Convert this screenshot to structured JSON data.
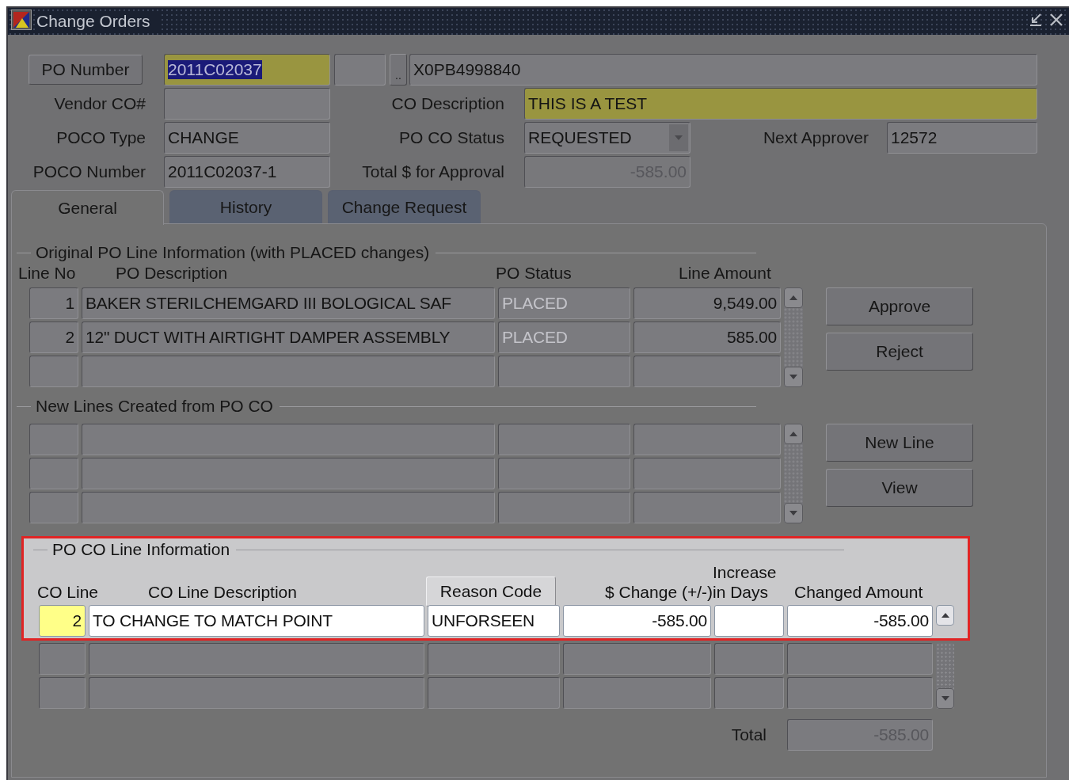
{
  "window": {
    "title": "Change Orders"
  },
  "header": {
    "po_number_button": "PO Number",
    "po_number": {
      "value": "2011C02037",
      "required": true,
      "disabled": false,
      "text_selected": true
    },
    "lov_button": "..",
    "po_reference": {
      "value": "X0PB4998840",
      "required": false,
      "disabled": false
    },
    "vendor_co": {
      "label": "Vendor CO#",
      "required": false
    },
    "co_description": {
      "label": "CO Description",
      "value": "THIS IS A TEST",
      "required": true,
      "disabled": false
    },
    "poco_type": {
      "label": "POCO Type",
      "value": "CHANGE",
      "required": false,
      "disabled": false
    },
    "po_co_status": {
      "label": "PO CO Status",
      "value": "REQUESTED",
      "required": false,
      "disabled": false
    },
    "next_approver": {
      "label": "Next Approver",
      "value": "12572",
      "required": false,
      "disabled": false
    },
    "poco_number": {
      "label": "POCO Number",
      "value": "2011C02037-1",
      "required": false,
      "disabled": false
    },
    "total_for_approval": {
      "label": "Total $ for Approval",
      "value": "-585.00",
      "required": false,
      "disabled": true
    }
  },
  "tabs": [
    {
      "label": "General",
      "selected": true
    },
    {
      "label": "History",
      "selected": false
    },
    {
      "label": "Change Request",
      "selected": false
    }
  ],
  "original_lines": {
    "title": "Original PO Line Information (with PLACED changes)",
    "columns": [
      "Line No",
      "PO Description",
      "PO Status",
      "Line Amount"
    ],
    "rows": [
      {
        "line_no": "1",
        "description": "BAKER STERILCHEMGARD III BOLOGICAL SAF",
        "status": "PLACED",
        "amount": "9,549.00"
      },
      {
        "line_no": "2",
        "description": "12\" DUCT WITH AIRTIGHT DAMPER ASSEMBLY",
        "status": "PLACED",
        "amount": "585.00"
      }
    ],
    "buttons": [
      "Approve",
      "Reject"
    ]
  },
  "new_lines": {
    "title": "New Lines Created from PO CO",
    "buttons": [
      "New Line",
      "View"
    ]
  },
  "co_lines": {
    "title": "PO CO Line Information",
    "highlighted": true,
    "columns": [
      {
        "label": "CO Line",
        "kind": "text"
      },
      {
        "label": "CO Line Description",
        "kind": "text"
      },
      {
        "label": "Reason Code",
        "kind": "button"
      },
      {
        "label": "$ Change (+/-)",
        "kind": "text"
      },
      {
        "label": "Increase in Days",
        "kind": "text"
      },
      {
        "label": "Changed Amount",
        "kind": "text"
      }
    ],
    "rows": [
      {
        "co_line": "2",
        "description": "TO CHANGE TO MATCH POINT",
        "reason_code": "UNFORSEEN",
        "change": "-585.00",
        "changed_amount": "-585.00",
        "selected": true
      }
    ],
    "total_label": "Total",
    "total": "-585.00"
  }
}
